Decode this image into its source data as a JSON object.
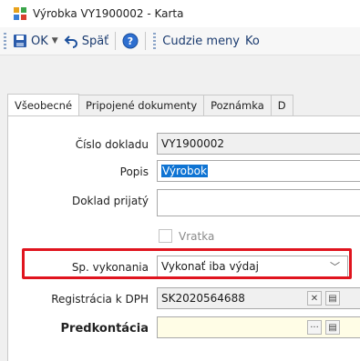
{
  "window": {
    "title": "Výrobka VY1900002 - Karta"
  },
  "toolbar": {
    "ok_label": "OK",
    "back_label": "Späť",
    "foreign_currency_label": "Cudzie meny",
    "cut_label": "Ko"
  },
  "tabs": [
    {
      "label": "Všeobecné"
    },
    {
      "label": "Pripojené dokumenty"
    },
    {
      "label": "Poznámka"
    },
    {
      "label": "D"
    }
  ],
  "form": {
    "cislo_dokladu": {
      "label": "Číslo dokladu",
      "value": "VY1900002"
    },
    "popis": {
      "label": "Popis",
      "value": "Výrobok"
    },
    "doklad_prijaty": {
      "label": "Doklad prijatý",
      "value": ""
    },
    "vratka": {
      "label": "Vratka",
      "checked": false
    },
    "sp_vykonania": {
      "label": "Sp. vykonania",
      "value": "Vykonať iba výdaj"
    },
    "registracia": {
      "label": "Registrácia k DPH",
      "value": "SK2020564688"
    },
    "predkontacia": {
      "label": "Predkontácia",
      "value": ""
    }
  },
  "colors": {
    "highlight": "#e0141e",
    "selection": "#0f74d3",
    "required_bg": "#fffde6"
  }
}
